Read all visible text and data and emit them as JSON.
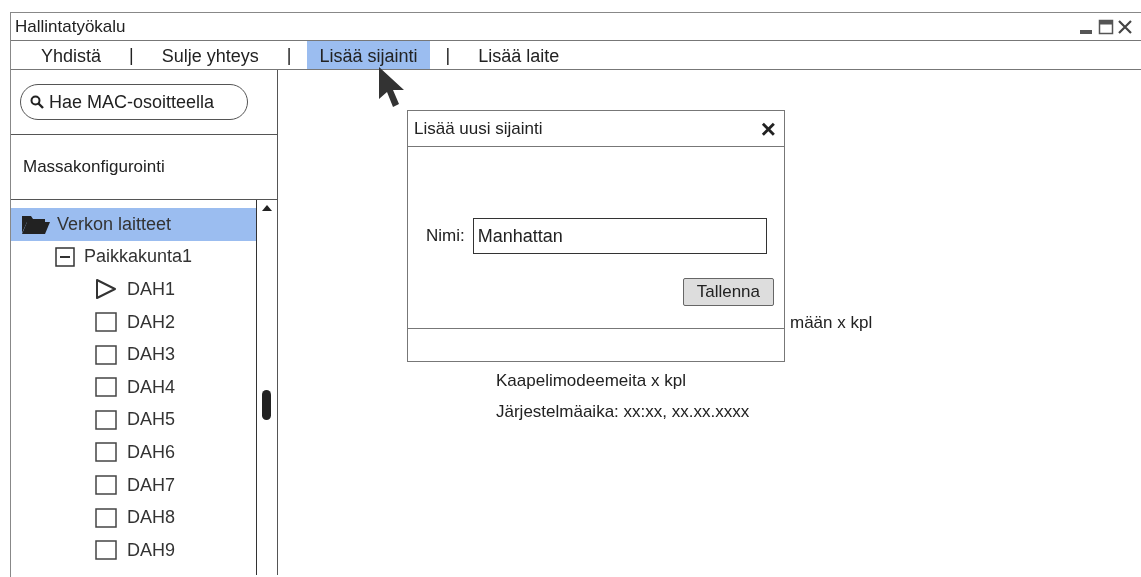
{
  "window": {
    "title": "Hallintatyökalu"
  },
  "menu": [
    {
      "label": "Yhdistä",
      "selected": false
    },
    {
      "label": "Sulje yhteys",
      "selected": false
    },
    {
      "label": "Lisää sijainti",
      "selected": true
    },
    {
      "label": "Lisää laite",
      "selected": false
    }
  ],
  "menu_separator": "|",
  "sidebar": {
    "search": {
      "placeholder": "Hae MAC-osoitteella"
    },
    "bulk_config": "Massakonfigurointi",
    "tree": [
      {
        "label": "Verkon laitteet",
        "selected": true,
        "children": [
          {
            "label": "Paikkakunta1",
            "expanded": true,
            "selected": false,
            "children": [
              {
                "label": "DAH1",
                "kind": "arrow",
                "selected": false
              },
              {
                "label": "DAH2",
                "kind": "checkbox",
                "selected": false
              },
              {
                "label": "DAH3",
                "kind": "checkbox",
                "selected": false
              },
              {
                "label": "DAH4",
                "kind": "checkbox",
                "selected": false
              },
              {
                "label": "DAH5",
                "kind": "checkbox",
                "selected": false
              },
              {
                "label": "DAH6",
                "kind": "checkbox",
                "selected": false
              },
              {
                "label": "DAH7",
                "kind": "checkbox",
                "selected": false
              },
              {
                "label": "DAH8",
                "kind": "checkbox",
                "selected": false
              },
              {
                "label": "DAH9",
                "kind": "checkbox",
                "selected": false
              }
            ]
          }
        ]
      }
    ]
  },
  "content": {
    "lines": [
      "mään x kpl",
      "Kaapelimodeemeita x kpl",
      "Järjestelmäaika: xx:xx, xx.xx.xxxx"
    ]
  },
  "dialog": {
    "title": "Lisää uusi sijainti",
    "close": "×",
    "name_label": "Nimi:",
    "name_value": "Manhattan",
    "save_button": "Tallenna"
  }
}
